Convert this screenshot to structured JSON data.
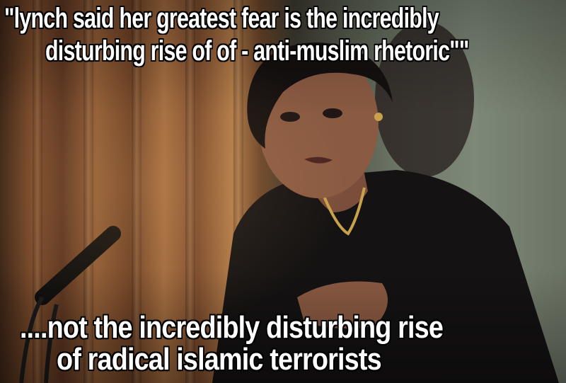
{
  "meme": {
    "top_text_line1": "\"lynch said her greatest fear is the incredibly",
    "top_text_line2": "disturbing rise of of - anti-muslim rhetoric\"\"",
    "bottom_text_line1": "....not the incredibly disturbing rise",
    "bottom_text_line2": "of radical islamic terrorists"
  }
}
